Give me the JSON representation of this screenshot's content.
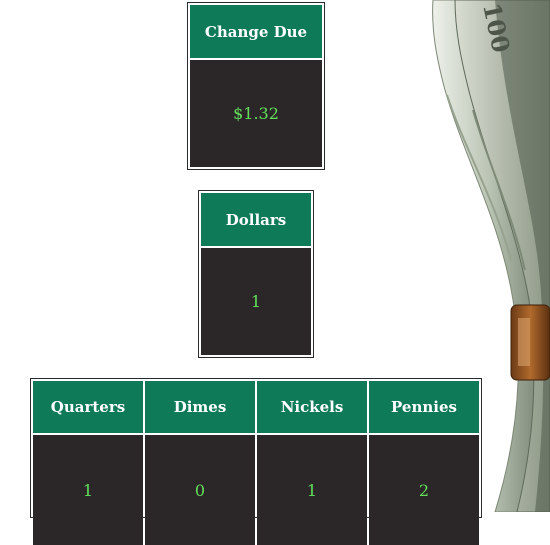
{
  "change_due": {
    "label": "Change Due",
    "value": "$1.32"
  },
  "dollars": {
    "label": "Dollars",
    "value": "1"
  },
  "coins": [
    {
      "label": "Quarters",
      "value": "1"
    },
    {
      "label": "Dimes",
      "value": "0"
    },
    {
      "label": "Nickels",
      "value": "1"
    },
    {
      "label": "Pennies",
      "value": "2"
    }
  ],
  "colors": {
    "header_bg": "#0f7a57",
    "value_bg": "#2b2728",
    "value_text": "#62e05a"
  },
  "decoration": {
    "image": "money-roll-illustration",
    "text_on_bill": "100"
  }
}
